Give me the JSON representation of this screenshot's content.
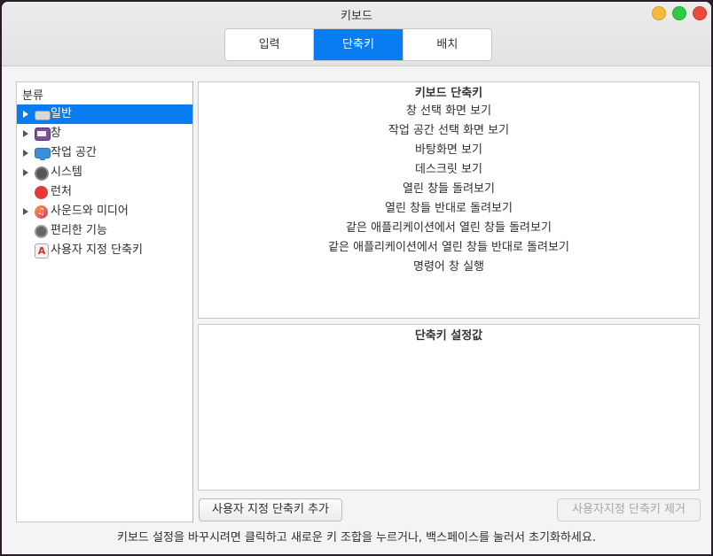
{
  "window": {
    "title": "키보드"
  },
  "tabs": [
    {
      "label": "입력"
    },
    {
      "label": "단축키"
    },
    {
      "label": "배치"
    }
  ],
  "active_tab": "단축키",
  "sidebar": {
    "header": "분류",
    "items": [
      {
        "label": "일반",
        "icon": "keyboard-icon",
        "expandable": true,
        "selected": true
      },
      {
        "label": "창",
        "icon": "window-icon",
        "expandable": true
      },
      {
        "label": "작업 공간",
        "icon": "workspace-icon",
        "expandable": true
      },
      {
        "label": "시스템",
        "icon": "system-icon",
        "expandable": true
      },
      {
        "label": "런처",
        "icon": "launcher-icon",
        "expandable": false
      },
      {
        "label": "사운드와 미디어",
        "icon": "media-icon",
        "expandable": true
      },
      {
        "label": "편리한 기능",
        "icon": "accessibility-icon",
        "expandable": false
      },
      {
        "label": "사용자 지정 단축키",
        "icon": "custom-shortcut-icon",
        "expandable": false
      }
    ]
  },
  "shortcuts": {
    "header": "키보드 단축키",
    "items": [
      "창 선택 화면 보기",
      "작업 공간 선택 화면 보기",
      "바탕화면 보기",
      "데스크릿 보기",
      "열린 창들 돌려보기",
      "열린 창들 반대로 돌려보기",
      "같은 애플리케이션에서 열린 창들 돌려보기",
      "같은 애플리케이션에서 열린 창들 반대로 돌려보기",
      "명령어 창 실행"
    ]
  },
  "values": {
    "header": "단축키 설정값"
  },
  "buttons": {
    "add": "사용자 지정 단축키 추가",
    "remove": "사용자지정 단축키 제거"
  },
  "hint": "키보드 설정을 바꾸시려면 클릭하고 새로운 키 조합을 누르거나, 백스페이스를 눌러서 초기화하세요.",
  "colors": {
    "accent": "#0a7cf2",
    "window_bg": "#f4f4f4",
    "close": "#e74c3c",
    "minimize": "#f6b93b",
    "maximize": "#2ecc40"
  }
}
